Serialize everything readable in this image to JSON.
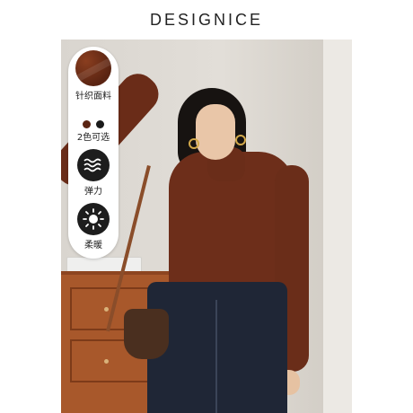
{
  "brand": {
    "name": "DESIGNICE"
  },
  "features": {
    "fabric_label": "针织面料",
    "colors_label": "2色可选",
    "elastic_label": "弹力",
    "warm_label": "柔暖"
  },
  "swatches": [
    "#5a2412",
    "#1a1a1a"
  ],
  "icons": {
    "fabric": "fabric-swatch-icon",
    "elastic": "wave-icon",
    "warm": "sun-icon"
  },
  "colors": {
    "garment": "#6d2e1a",
    "icon_bg": "#1d1d1d",
    "dresser": "#a8582b",
    "jeans": "#1f2636"
  }
}
